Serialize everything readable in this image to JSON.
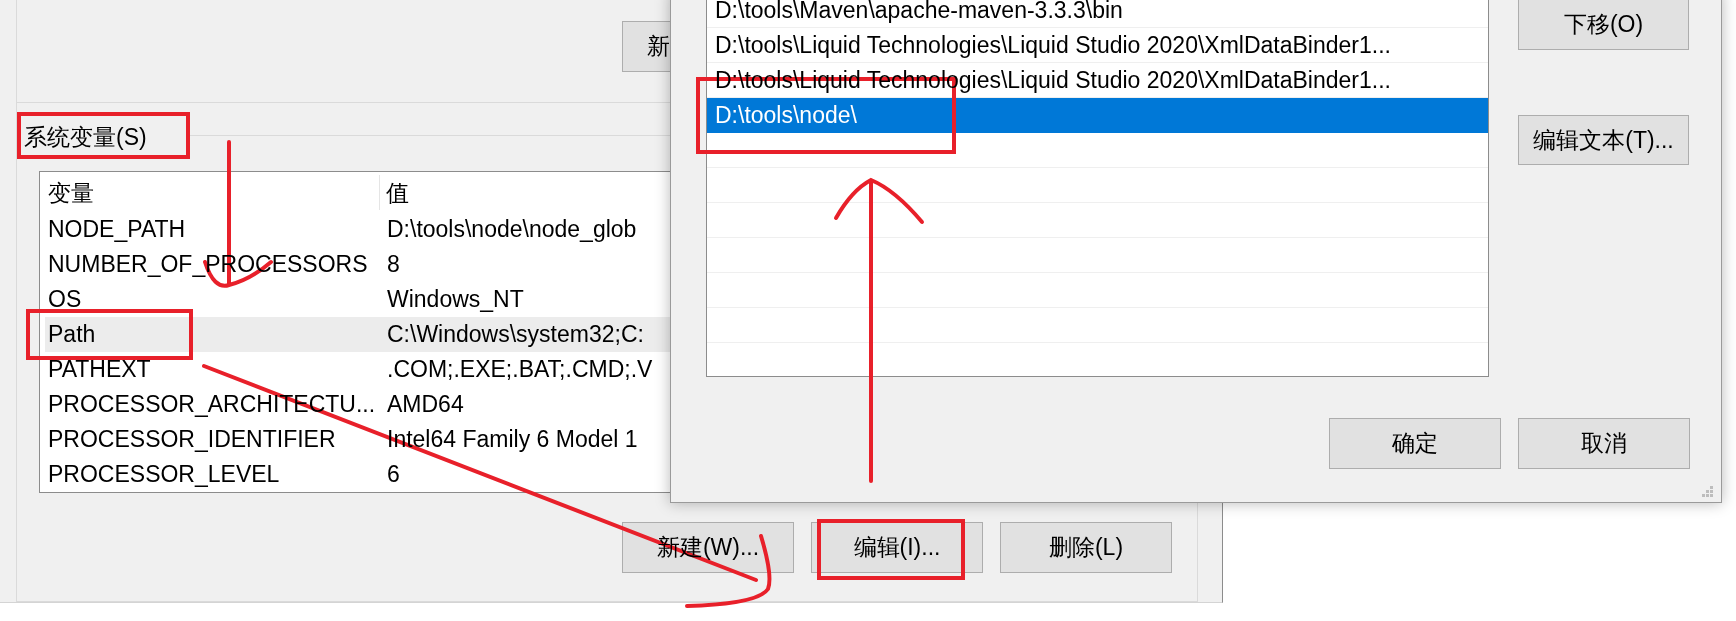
{
  "system_variables_dialog": {
    "top_button": {
      "label": "新"
    },
    "section_label": {
      "label": "系统变量(S)"
    },
    "table": {
      "columns": [
        "变量",
        "值"
      ],
      "rows": [
        {
          "name": "NODE_PATH",
          "value": "D:\\tools\\node\\node_glob",
          "selected": false
        },
        {
          "name": "NUMBER_OF_PROCESSORS",
          "value": "8",
          "selected": false
        },
        {
          "name": "OS",
          "value": "Windows_NT",
          "selected": false
        },
        {
          "name": "Path",
          "value": "C:\\Windows\\system32;C:",
          "selected": true
        },
        {
          "name": "PATHEXT",
          "value": ".COM;.EXE;.BAT;.CMD;.V",
          "selected": false
        },
        {
          "name": "PROCESSOR_ARCHITECTU...",
          "value": "AMD64",
          "selected": false
        },
        {
          "name": "PROCESSOR_IDENTIFIER",
          "value": "Intel64 Family 6 Model 1",
          "selected": false
        },
        {
          "name": "PROCESSOR_LEVEL",
          "value": "6",
          "selected": false
        }
      ]
    },
    "buttons": [
      {
        "label": "新建(W)..."
      },
      {
        "label": "编辑(I)..."
      },
      {
        "label": "删除(L)"
      }
    ]
  },
  "edit_path_dialog": {
    "entries": [
      {
        "text": "D:\\tools\\Maven\\apache-maven-3.3.3\\bin",
        "selected": false
      },
      {
        "text": "D:\\tools\\Liquid Technologies\\Liquid Studio 2020\\XmlDataBinder1...",
        "selected": false
      },
      {
        "text": "D:\\tools\\Liquid Technologies\\Liquid Studio 2020\\XmlDataBinder1...",
        "selected": false
      },
      {
        "text": "D:\\tools\\node\\",
        "selected": true
      }
    ],
    "side_buttons": [
      {
        "label": "下移(O)"
      },
      {
        "label": "编辑文本(T)..."
      }
    ],
    "footer_buttons": [
      {
        "label": "确定"
      },
      {
        "label": "取消"
      }
    ]
  }
}
